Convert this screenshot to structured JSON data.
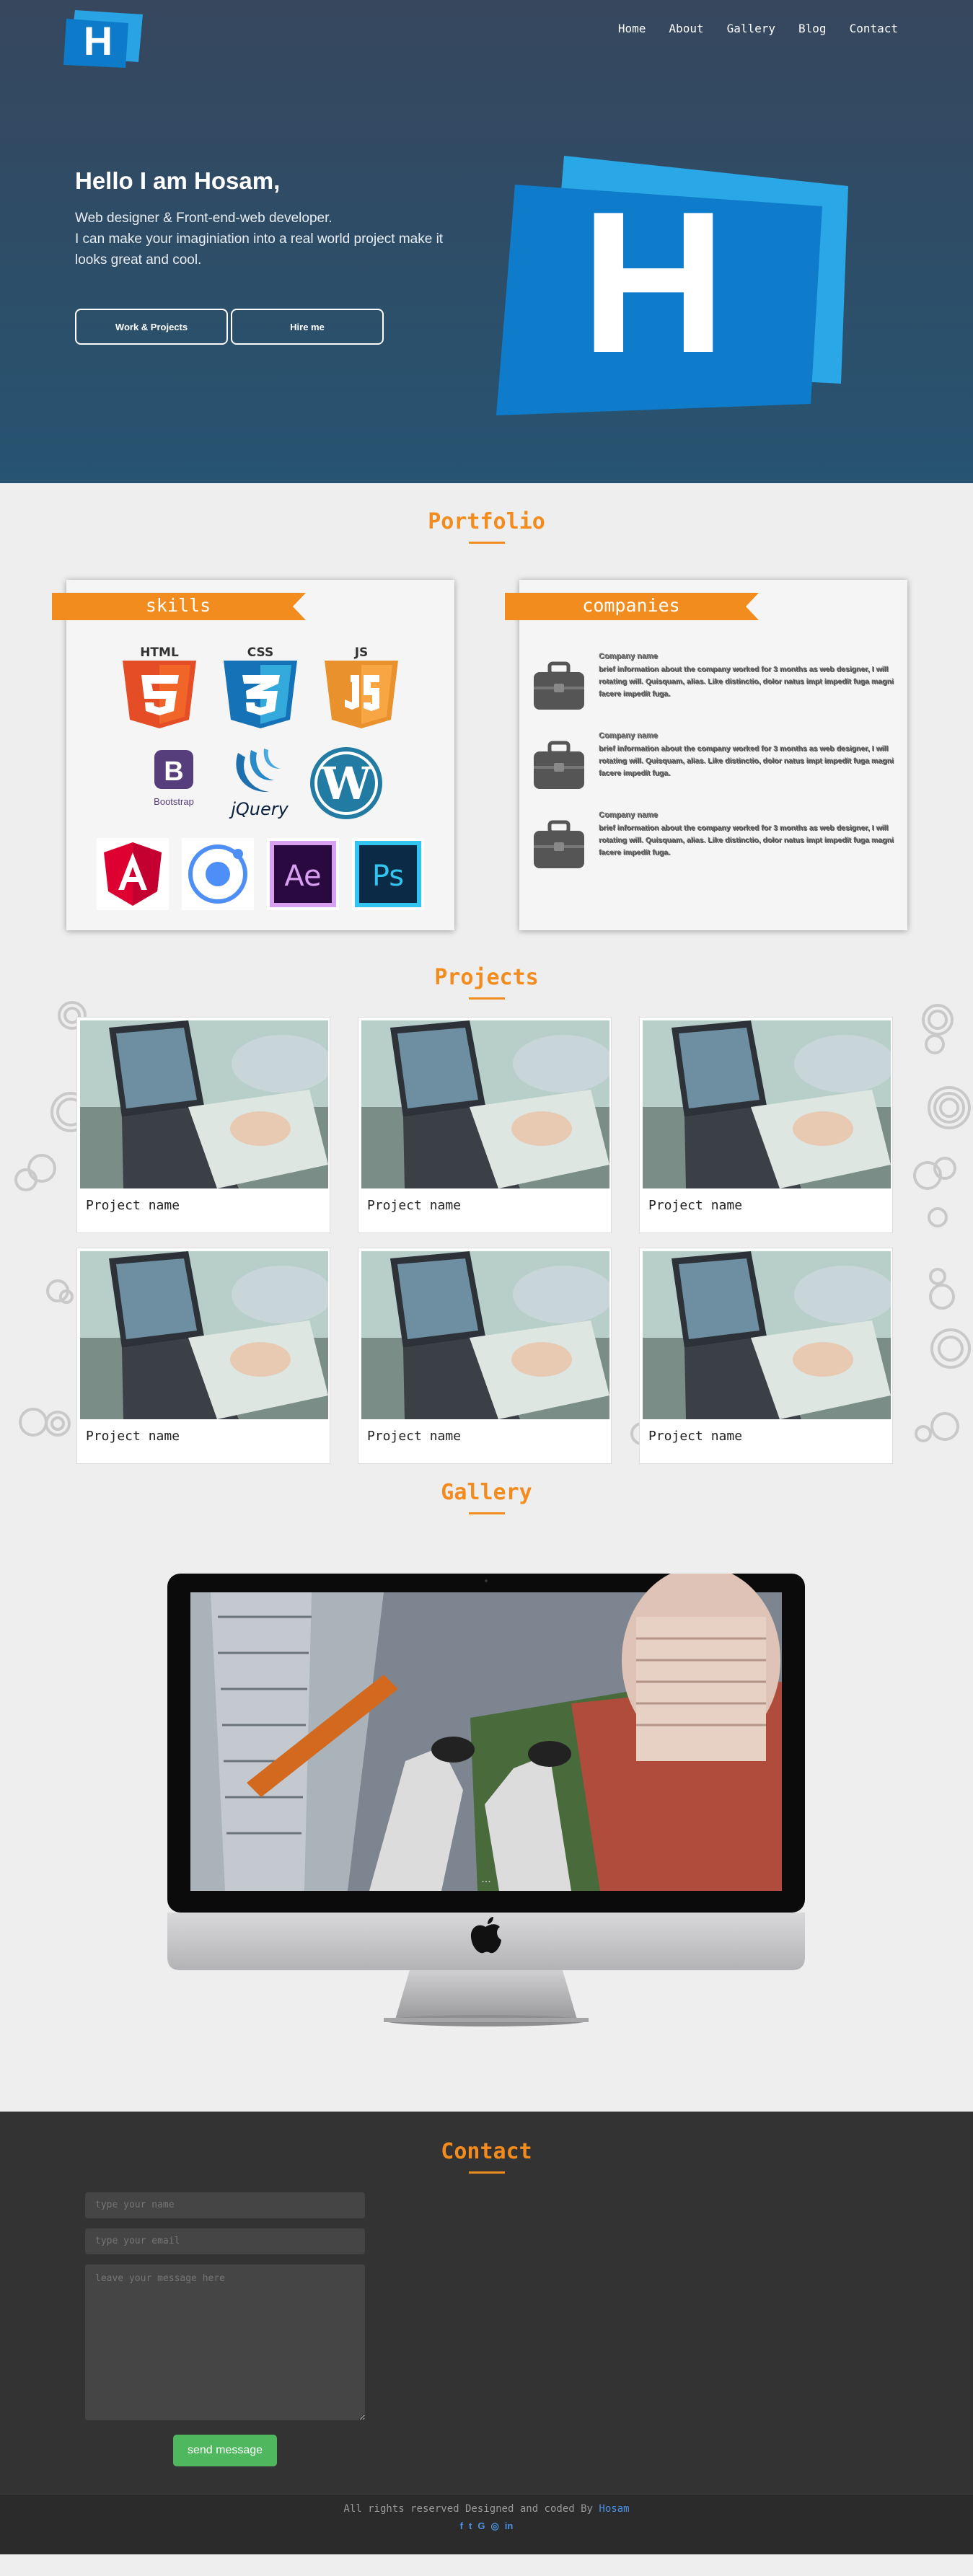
{
  "nav": {
    "items": [
      "Home",
      "About",
      "Gallery",
      "Blog",
      "Contact"
    ]
  },
  "hero": {
    "logo_letter": "H",
    "title": "Hello I am Hosam,",
    "line1": "Web designer & Front-end-web developer.",
    "line2": "I can make your imaginiation into a real world project make it",
    "line3": "looks great and cool.",
    "btn_work": "Work & Projects",
    "btn_hire": "Hire me"
  },
  "portfolio": {
    "title": "Portfolio",
    "skills_label": "skills",
    "companies_label": "companies",
    "skill_icons": [
      "HTML",
      "CSS",
      "JS",
      "Bootstrap",
      "jQuery",
      "wordpress",
      "angular",
      "ionic",
      "Ae",
      "Ps"
    ],
    "companies": [
      {
        "name": "Company name",
        "desc": "brief information about the company worked for 3 months as web designer, I will rotating will. Quisquam, alias. Like distinctio, dolor natus impt impedit fuga magni facere impedit fuga."
      },
      {
        "name": "Company name",
        "desc": "brief information about the company worked for 3 months as web designer, I will rotating will. Quisquam, alias. Like distinctio, dolor natus impt impedit fuga magni facere impedit fuga."
      },
      {
        "name": "Company name",
        "desc": "brief information about the company worked for 3 months as web designer, I will rotating will. Quisquam, alias. Like distinctio, dolor natus impt impedit fuga magni facere impedit fuga."
      }
    ]
  },
  "projects": {
    "title": "Projects",
    "items": [
      {
        "name": "Project name"
      },
      {
        "name": "Project name"
      },
      {
        "name": "Project name"
      },
      {
        "name": "Project name"
      },
      {
        "name": "Project name"
      },
      {
        "name": "Project name"
      }
    ]
  },
  "gallery": {
    "title": "Gallery",
    "slide_dots": "..."
  },
  "contact": {
    "title": "Contact",
    "name_placeholder": "type your name",
    "email_placeholder": "type your email",
    "message_placeholder": "leave your message here",
    "send_label": "send message"
  },
  "footer": {
    "copy_text": "All rights reserved Designed and coded By ",
    "author": "Hosam",
    "social_icons": [
      "facebook-icon",
      "twitter-icon",
      "google-plus-icon",
      "instagram-icon",
      "linkedin-icon"
    ],
    "social_glyphs": [
      "f",
      "t",
      "G",
      "◎",
      "in"
    ]
  },
  "colors": {
    "accent": "#f28c1e",
    "hero_bg": "#2f4c66",
    "logo_blue": "#1384d4",
    "send_green": "#4fb75d",
    "link_blue": "#4a90e2"
  }
}
